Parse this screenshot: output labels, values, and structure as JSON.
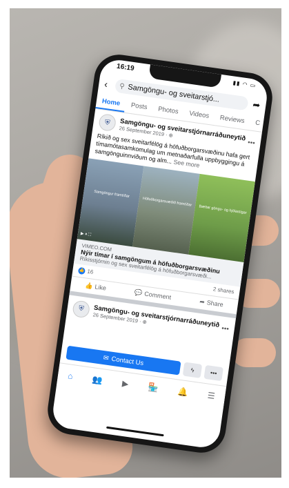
{
  "status": {
    "time": "16:19"
  },
  "search": {
    "query": "Samgöngu- og sveitarstjó..."
  },
  "tabs": [
    "Home",
    "Posts",
    "Photos",
    "Videos",
    "Reviews",
    "C"
  ],
  "post1": {
    "author": "Samgöngu- og sveitarstjórnarráðuneytið",
    "date": "26 September 2019 · ⊕",
    "text": "Ríkið og sex sveitarfélög á höfuðborgarsvæðinu hafa gert tímamótasamkomulag um metnaðarfulla uppbyggingu á samgönguinnviðum og alm...",
    "see_more": "See more",
    "media_captions": [
      "Samgöngur framtíðar",
      "Höfuðborgarsvæðið framtíðar",
      "Bættar göngu- og hjólastígar"
    ],
    "link_domain": "VIMEO.COM",
    "link_title": "Nýir tímar í samgöngum á höfuðborgarsvæðinu",
    "link_desc": "Ríkisstjórnin og sex sveitarfélög á höfuðborgarsvæði...",
    "likes": "16",
    "shares": "2 shares",
    "actions": {
      "like": "Like",
      "comment": "Comment",
      "share": "Share"
    }
  },
  "post2": {
    "author": "Samgöngu- og sveitarstjórnarráðuneytið",
    "date": "26 September 2019 · ⊕"
  },
  "cta": {
    "contact": "Contact Us"
  },
  "colors": {
    "accent": "#1877f2",
    "phone": "#161616",
    "skin": "#e2b49a"
  }
}
